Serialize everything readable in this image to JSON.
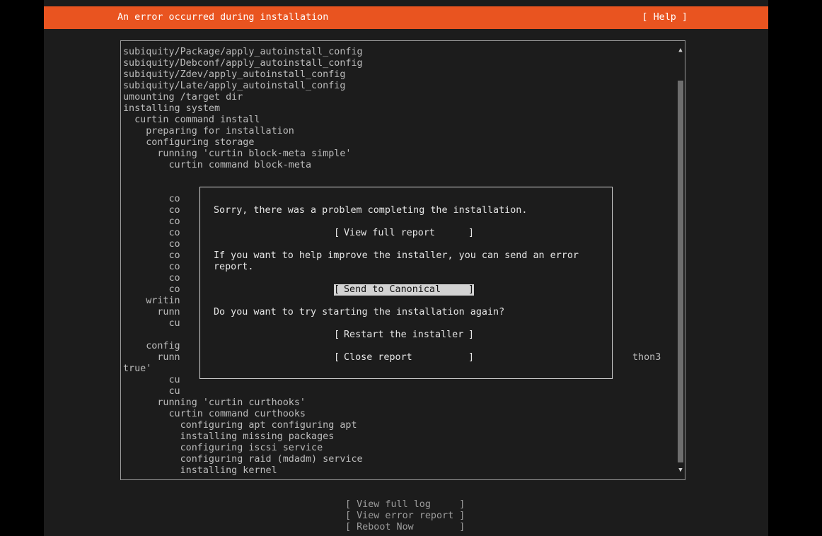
{
  "header": {
    "title": "An error occurred during installation",
    "help_label": "[ Help ]"
  },
  "log": {
    "lines": [
      "subiquity/Package/apply_autoinstall_config",
      "subiquity/Debconf/apply_autoinstall_config",
      "subiquity/Zdev/apply_autoinstall_config",
      "subiquity/Late/apply_autoinstall_config",
      "umounting /target dir",
      "installing system",
      "  curtin command install",
      "    preparing for installation",
      "    configuring storage",
      "      running 'curtin block-meta simple'",
      "        curtin command block-meta",
      "",
      "",
      "        co",
      "        co",
      "        co",
      "        co",
      "        co",
      "        co",
      "        co",
      "        co",
      "        co",
      "    writin",
      "      runn",
      "        cu",
      "",
      "    config",
      "      runn",
      "true'",
      "        cu",
      "        cu",
      "      running 'curtin curthooks'",
      "        curtin command curthooks",
      "          configuring apt configuring apt",
      "          installing missing packages",
      "          configuring iscsi service",
      "          configuring raid (mdadm) service",
      "          installing kernel"
    ],
    "partial_right": "thon3",
    "scroll_up_glyph": "▲",
    "scroll_down_glyph": "▼"
  },
  "dialog": {
    "message1": "Sorry, there was a problem completing the installation.",
    "view_report_label": "View full report",
    "message2_line1": "If you want to help improve the installer, you can send an error",
    "message2_line2": "report.",
    "send_label": "Send to Canonical",
    "message3": "Do you want to try starting the installation again?",
    "restart_label": "Restart the installer",
    "close_label": "Close report",
    "bracket_open": "[",
    "bracket_close": "]"
  },
  "footer": {
    "view_log": "[ View full log     ]",
    "view_error": "[ View error report ]",
    "reboot": "[ Reboot Now        ]"
  }
}
